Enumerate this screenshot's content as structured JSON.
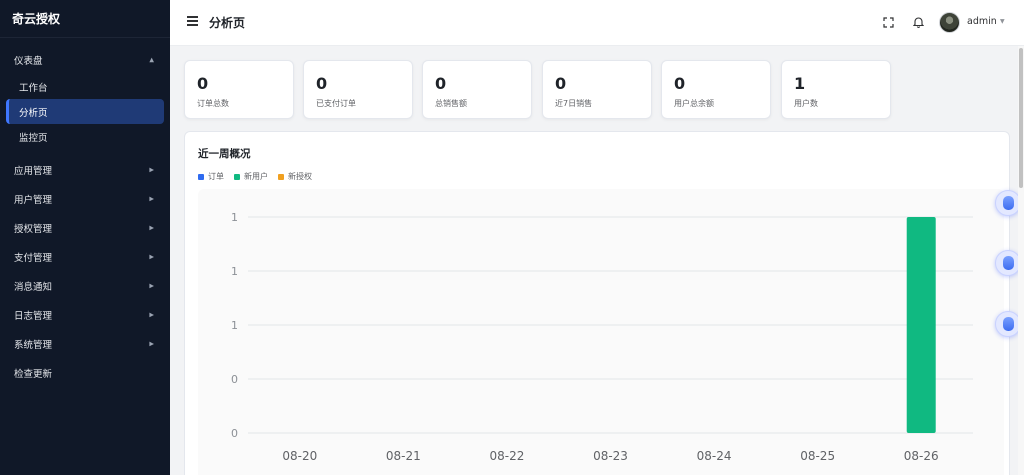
{
  "app": {
    "brand": "奇云授权"
  },
  "sidebar": {
    "dashboard": {
      "label": "仪表盘",
      "children": [
        "工作台",
        "分析页",
        "监控页"
      ]
    },
    "items": [
      "应用管理",
      "用户管理",
      "授权管理",
      "支付管理",
      "消息通知",
      "日志管理",
      "系统管理"
    ],
    "check_update": "检查更新"
  },
  "header": {
    "title": "分析页",
    "username": "admin"
  },
  "stats": [
    {
      "value": "0",
      "label": "订单总数"
    },
    {
      "value": "0",
      "label": "已支付订单"
    },
    {
      "value": "0",
      "label": "总销售额"
    },
    {
      "value": "0",
      "label": "近7日销售"
    },
    {
      "value": "0",
      "label": "用户总余额"
    },
    {
      "value": "1",
      "label": "用户数"
    }
  ],
  "panel": {
    "title": "近一周概况"
  },
  "colors": {
    "orders": "#2f6bf0",
    "new_users": "#10b981",
    "new_licenses": "#f0a020",
    "sidebar_bg": "#101828",
    "active": "#1f3a76"
  },
  "chart_data": {
    "type": "bar",
    "categories": [
      "08-20",
      "08-21",
      "08-22",
      "08-23",
      "08-24",
      "08-25",
      "08-26"
    ],
    "series": [
      {
        "name": "订单",
        "values": [
          0,
          0,
          0,
          0,
          0,
          0,
          0
        ]
      },
      {
        "name": "新用户",
        "values": [
          0,
          0,
          0,
          0,
          0,
          0,
          1
        ]
      },
      {
        "name": "新授权",
        "values": [
          0,
          0,
          0,
          0,
          0,
          0,
          0
        ]
      }
    ],
    "yticks": [
      "1",
      "1",
      "1",
      "0",
      "0"
    ],
    "ylim": [
      0,
      1
    ],
    "grid": true,
    "legend": "top-left"
  }
}
